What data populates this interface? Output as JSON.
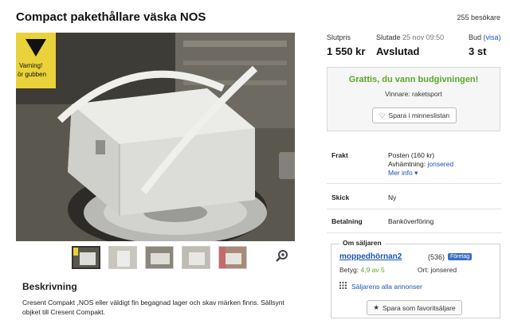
{
  "listing": {
    "title": "Compact pakethållare väska NOS",
    "visitors": "255 besökare"
  },
  "status": {
    "final_price_label": "Slutpris",
    "final_price": "1 550 kr",
    "ended_label": "Slutade",
    "ended_date": "25 nov 09:50",
    "ended_value": "Avslutad",
    "bids_label": "Bud",
    "bids_link": "(visa)",
    "bids_value": "3 st"
  },
  "win_box": {
    "headline": "Grattis, du vann budgivningen!",
    "winner": "Vinnare: raketsport",
    "save_button": "Spara i minneslistan"
  },
  "details": {
    "shipping_label": "Frakt",
    "shipping_line1": "Posten (160 kr)",
    "shipping_line2_prefix": "Avhämtning:",
    "shipping_line2_place": "jonsered",
    "more_info": "Mer info",
    "condition_label": "Skick",
    "condition_value": "Ny",
    "payment_label": "Betalning",
    "payment_value": "Banköverföring"
  },
  "seller": {
    "legend": "Om säljaren",
    "name": "moppedhörnan2",
    "count": "(536)",
    "badge": "Företag",
    "rating_prefix": "Betyg:",
    "rating_value": "4,9 av 5",
    "place": "Ort: jonsered",
    "all_ads": "Säljarens alla annonser",
    "favorite_button": "Spara som favoritsäljare"
  },
  "description": {
    "heading": "Beskrivning",
    "text": "Cresent Compakt ,NOS eller väldigt fin begagnad lager och skav märken finns. Sällsynt objket till Cresent Compakt."
  },
  "photo": {
    "sign_text_1": "Varning!",
    "sign_text_2": "ör gubben"
  },
  "colors": {
    "accent_green": "#5ba829",
    "link_blue": "#1a55b3",
    "badge_blue": "#3a6fc4"
  }
}
